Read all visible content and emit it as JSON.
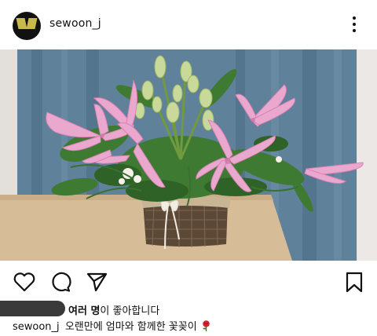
{
  "post": {
    "username": "sewoon_j",
    "likes": {
      "bold_part": "여러 명",
      "rest": "이 좋아합니다"
    },
    "caption": {
      "username": "sewoon_j",
      "text": "오랜만에 엄마와 함께한 꽃꽂이"
    }
  },
  "icons": {
    "avatar": "avatar-image",
    "more": "more-options-icon",
    "like": "heart-icon",
    "comment": "comment-icon",
    "share": "share-icon",
    "save": "bookmark-icon",
    "caption_emoji": "rose-emoji"
  },
  "colors": {
    "wall": "#e4e0dc",
    "curtain": "#5d7f97",
    "table": "#d8c09c",
    "lily_pink": "#e69bc4",
    "leaf_green": "#3f7a33",
    "likes_mask": "#3a3a3a"
  }
}
